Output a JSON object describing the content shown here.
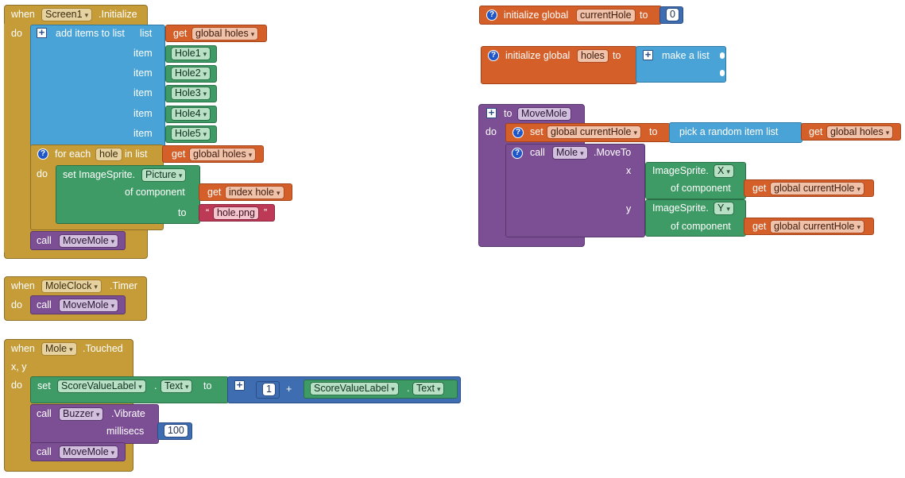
{
  "kw": {
    "when": "when",
    "do": "do",
    "call": "call",
    "set": "set",
    "get": "get",
    "to": "to",
    "item": "item",
    "x": "x",
    "y": "y",
    "xy": "x,  y",
    "for_each": "for each",
    "in_list": "in list",
    "of_component": "of component",
    "millisecs": "millisecs",
    "plus": "+",
    "dot": ".",
    "quote_open": "“",
    "quote_close": "”"
  },
  "screen_init": {
    "component": "Screen1",
    "event": ".Initialize",
    "add_items": "add items to list",
    "list_label": "list",
    "global_holes": "global holes",
    "items": [
      "Hole1",
      "Hole2",
      "Hole3",
      "Hole4",
      "Hole5"
    ],
    "loop_var": "hole",
    "set_prefix": "set ImageSprite.",
    "property": "Picture",
    "index_var": "index hole",
    "text_value": "hole.png",
    "call_proc": "MoveMole"
  },
  "clock_timer": {
    "component": "MoleClock",
    "event": ".Timer",
    "call_proc": "MoveMole"
  },
  "mole_touched": {
    "component": "Mole",
    "event": ".Touched",
    "label_component": "ScoreValueLabel",
    "property": "Text",
    "number": "1",
    "rhs_component": "ScoreValueLabel",
    "rhs_property": "Text",
    "buzzer": "Buzzer",
    "buzz_method": ".Vibrate",
    "millis": "100",
    "call_proc": "MoveMole"
  },
  "globals": {
    "init_global": "initialize global",
    "current_hole": "currentHole",
    "current_hole_value": "0",
    "holes": "holes",
    "make_list": "make a list"
  },
  "proc": {
    "to": "to",
    "name": "MoveMole",
    "set_global": "global currentHole",
    "pick_random": "pick a random item  list",
    "get_global_holes": "global holes",
    "mole": "Mole",
    "move_to": ".MoveTo",
    "sprite_prefix": "ImageSprite.",
    "x_prop": "X",
    "y_prop": "Y",
    "get_current_hole": "global currentHole"
  },
  "colors": {
    "event": "#c69c39",
    "list": "#4aa3d6",
    "variable": "#d55f29",
    "component": "#3f9b66",
    "procedure": "#7c4f95",
    "math": "#3e6db2",
    "text": "#bd3a57"
  }
}
